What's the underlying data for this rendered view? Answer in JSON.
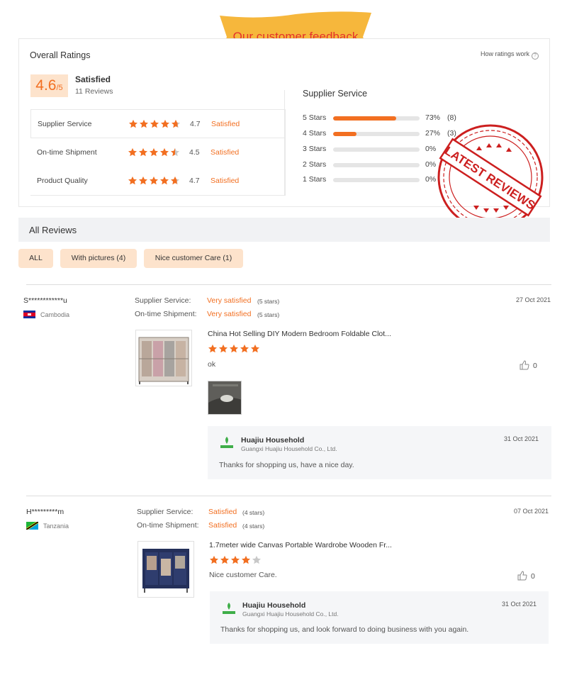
{
  "banner": {
    "text": "Our customer feedback"
  },
  "overall": {
    "title": "Overall Ratings",
    "how_link": "How ratings work",
    "score": "4.6",
    "score_suffix": "/5",
    "status": "Satisfied",
    "reviews_count": "11 Reviews",
    "categories": [
      {
        "label": "Supplier Service",
        "stars": 4.7,
        "score": "4.7",
        "status": "Satisfied"
      },
      {
        "label": "On-time Shipment",
        "stars": 4.5,
        "score": "4.5",
        "status": "Satisfied"
      },
      {
        "label": "Product Quality",
        "stars": 4.7,
        "score": "4.7",
        "status": "Satisfied"
      }
    ]
  },
  "supplier_service": {
    "title": "Supplier Service",
    "distribution": [
      {
        "label": "5  Stars",
        "percent": 73,
        "pct_text": "73%",
        "count_text": "(8)"
      },
      {
        "label": "4  Stars",
        "percent": 27,
        "pct_text": "27%",
        "count_text": "(3)"
      },
      {
        "label": "3  Stars",
        "percent": 0,
        "pct_text": "0%",
        "count_text": ""
      },
      {
        "label": "2  Stars",
        "percent": 0,
        "pct_text": "0%",
        "count_text": ""
      },
      {
        "label": "1  Stars",
        "percent": 0,
        "pct_text": "0%",
        "count_text": ""
      }
    ]
  },
  "stamp": {
    "text": "LATEST REVIEWS"
  },
  "all_reviews": {
    "title": "All Reviews",
    "filters": [
      "ALL",
      "With pictures (4)",
      "Nice customer Care (1)"
    ]
  },
  "reviews": [
    {
      "reviewer": "S************u",
      "country": "Cambodia",
      "supplier_label": "Supplier Service:",
      "supplier_status": "Very satisfied",
      "supplier_stars": "(5 stars)",
      "shipment_label": "On-time Shipment:",
      "shipment_status": "Very satisfied",
      "shipment_stars": "(5 stars)",
      "date": "27 Oct 2021",
      "product_title": "China Hot Selling DIY Modern Bedroom Foldable Clot...",
      "rating": 5,
      "text": "ok",
      "likes": "0",
      "reply": {
        "name": "Huajiu Household",
        "company": "Guangxi Huajiu Household Co., Ltd.",
        "date": "31 Oct 2021",
        "text": "Thanks for shopping us, have a nice day."
      }
    },
    {
      "reviewer": "H*********m",
      "country": "Tanzania",
      "supplier_label": "Supplier Service:",
      "supplier_status": "Satisfied",
      "supplier_stars": "(4 stars)",
      "shipment_label": "On-time Shipment:",
      "shipment_status": "Satisfied",
      "shipment_stars": "(4 stars)",
      "date": "07 Oct 2021",
      "product_title": "1.7meter wide Canvas Portable Wardrobe Wooden Fr...",
      "rating": 4,
      "text": "Nice customer Care.",
      "likes": "0",
      "reply": {
        "name": "Huajiu Household",
        "company": "Guangxi Huajiu Household Co., Ltd.",
        "date": "31 Oct 2021",
        "text": "Thanks for shopping us, and look forward to doing business with you again."
      }
    }
  ],
  "colors": {
    "accent": "#f26f21",
    "star_empty": "#c8c8c8",
    "stamp_red": "#cc1f1f",
    "banner_yellow": "#f6b73c"
  },
  "icons": [
    "question-circle-icon",
    "star-icon",
    "thumbs-up-icon",
    "cambodia-flag-icon",
    "tanzania-flag-icon",
    "seller-logo-icon"
  ]
}
